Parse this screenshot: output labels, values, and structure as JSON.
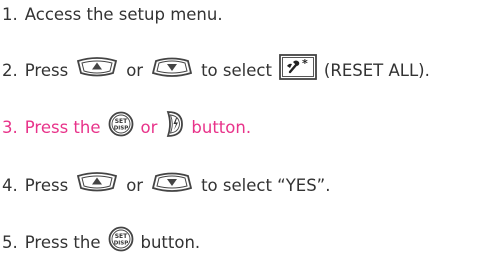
{
  "colors": {
    "text": "#333333",
    "highlight": "#e8338a",
    "icon": "#444444"
  },
  "steps": [
    {
      "num": "1.",
      "text": "Access the setup menu."
    },
    {
      "num": "2.",
      "pre": "Press",
      "or": "or",
      "post": "to select",
      "post2": "(RESET ALL).",
      "icons": [
        "up-button-icon",
        "down-button-icon",
        "reset-all-icon"
      ]
    },
    {
      "num": "3.",
      "pre": "Press the",
      "or": "or",
      "post": "button.",
      "icons": [
        "set-disp-button-icon",
        "flash-button-icon"
      ],
      "set_label": "SET",
      "disp_label": "DISP"
    },
    {
      "num": "4.",
      "pre": "Press",
      "or": "or",
      "post": "to select “YES”.",
      "icons": [
        "up-button-icon",
        "down-button-icon"
      ]
    },
    {
      "num": "5.",
      "pre": "Press the",
      "post": "button.",
      "icons": [
        "set-disp-button-icon"
      ],
      "set_label": "SET",
      "disp_label": "DISP"
    }
  ]
}
